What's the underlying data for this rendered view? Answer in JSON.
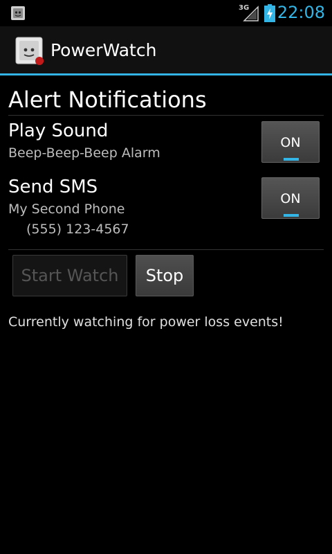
{
  "status_bar": {
    "network_type": "3G",
    "clock": "22:08",
    "notification_icon": "power-plug-icon",
    "signal_icon": "signal-icon",
    "battery_icon": "battery-charging-icon",
    "accent_color": "#33b5e5"
  },
  "action_bar": {
    "title": "PowerWatch",
    "icon": "power-plug-app-icon"
  },
  "alert_notifications": {
    "heading": "Alert Notifications",
    "play_sound": {
      "title": "Play Sound",
      "subtitle": "Beep-Beep-Beep Alarm",
      "toggle_label": "ON",
      "enabled": true
    },
    "send_sms": {
      "title": "Send SMS",
      "subtitle": "My Second Phone",
      "phone": "(555) 123-4567",
      "toggle_label": "ON",
      "enabled": true
    }
  },
  "controls": {
    "start_label": "Start Watch",
    "start_enabled": false,
    "stop_label": "Stop",
    "stop_enabled": true
  },
  "status_message": "Currently watching for power loss events!"
}
